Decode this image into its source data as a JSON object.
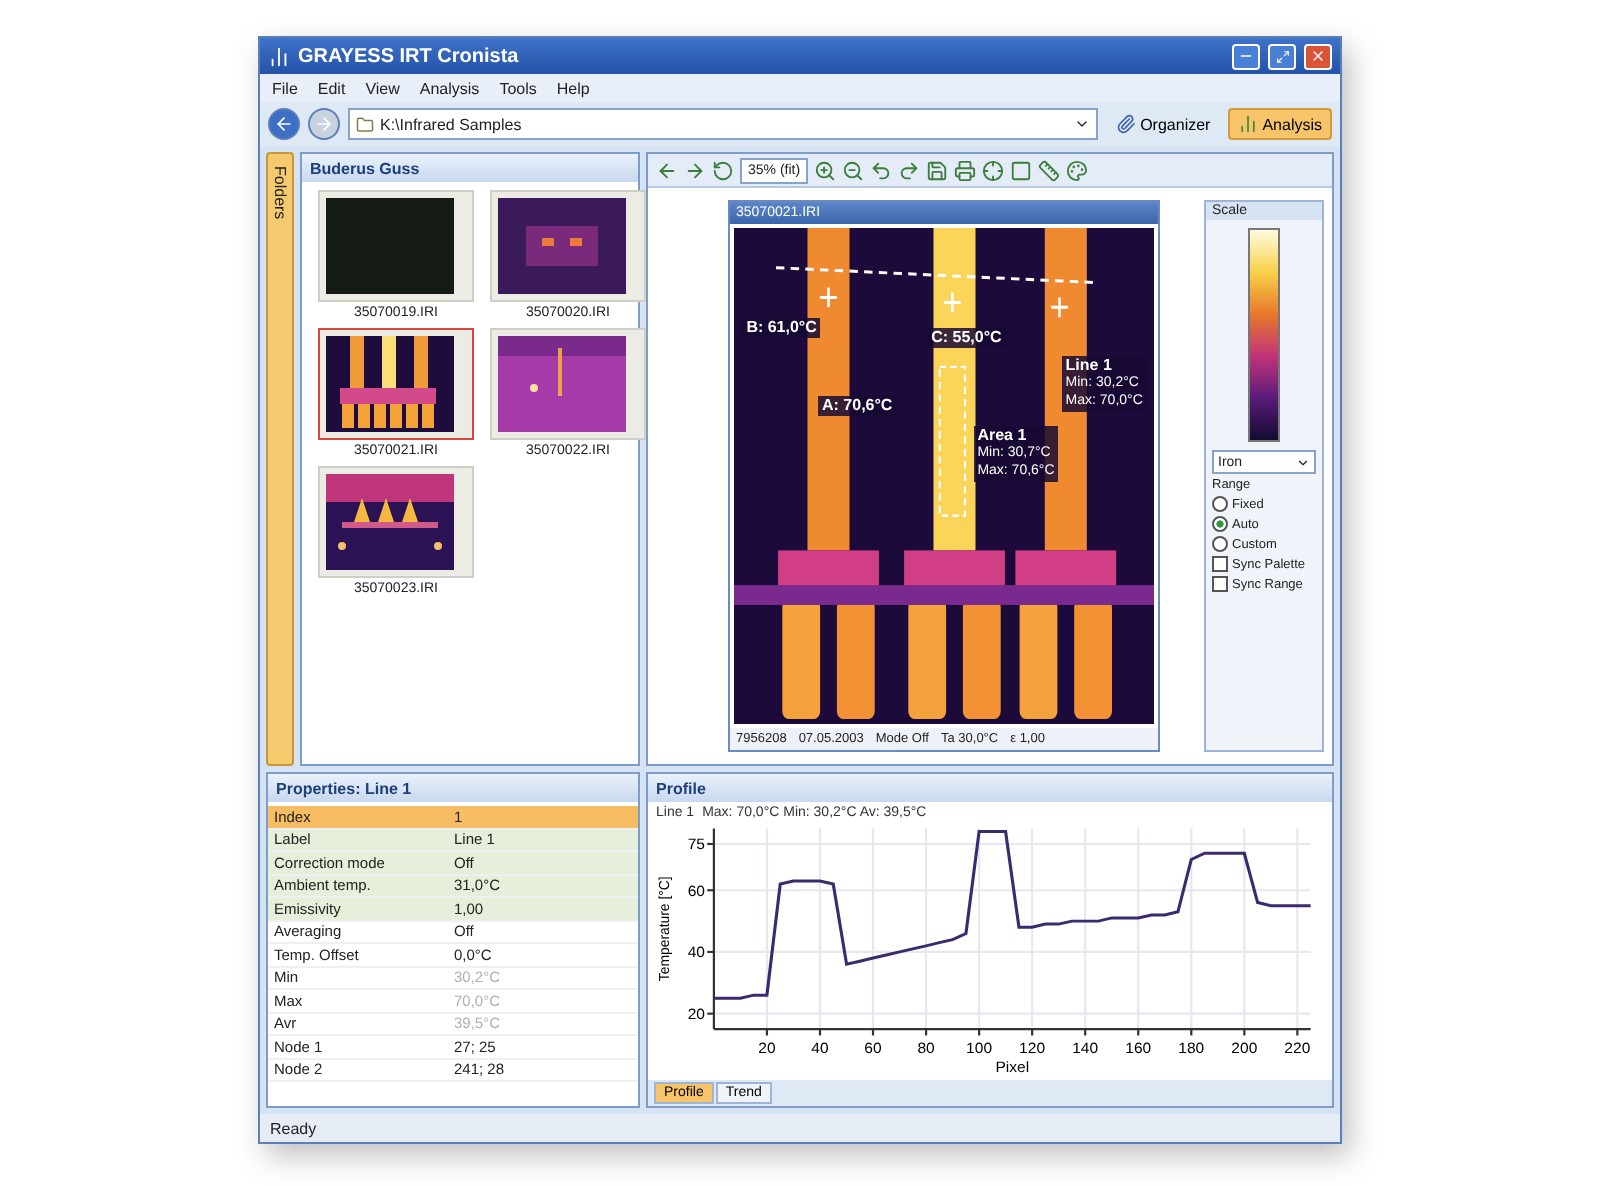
{
  "window": {
    "title": "GRAYESS IRT Cronista"
  },
  "menu": [
    "File",
    "Edit",
    "View",
    "Analysis",
    "Tools",
    "Help"
  ],
  "address": {
    "path": "K:\\Infrared Samples"
  },
  "modes": [
    {
      "label": "Organizer",
      "selected": false
    },
    {
      "label": "Analysis",
      "selected": true
    }
  ],
  "side_tab": "Folders",
  "browser": {
    "title": "Buderus Guss",
    "thumbnails": [
      {
        "name": "35070019.IRI",
        "selected": false,
        "kind": "dark"
      },
      {
        "name": "35070020.IRI",
        "selected": false,
        "kind": "glow"
      },
      {
        "name": "35070021.IRI",
        "selected": true,
        "kind": "busbar"
      },
      {
        "name": "35070022.IRI",
        "selected": false,
        "kind": "plate"
      },
      {
        "name": "35070023.IRI",
        "selected": false,
        "kind": "fuses"
      }
    ]
  },
  "toolbar": {
    "zoom": "35% (fit)"
  },
  "image": {
    "title": "35070021.IRI",
    "annotations": [
      {
        "kind": "spot",
        "text": "B: 61,0°C"
      },
      {
        "kind": "spot",
        "text": "A: 70,6°C"
      },
      {
        "kind": "spot",
        "text": "C: 55,0°C"
      },
      {
        "kind": "area",
        "text": "Area 1",
        "lines": [
          "Min: 30,7°C",
          "Max: 70,6°C"
        ]
      },
      {
        "kind": "line",
        "text": "Line 1",
        "lines": [
          "Min: 30,2°C",
          "Max: 70,0°C"
        ]
      }
    ],
    "status": [
      "7956208",
      "07.05.2003",
      "Mode Off",
      "Ta 30,0°C",
      "ε 1,00"
    ]
  },
  "scale": {
    "title": "Scale",
    "palette": "Iron",
    "range_label": "Range",
    "range_options": [
      {
        "label": "Fixed",
        "selected": false
      },
      {
        "label": "Auto",
        "selected": true
      },
      {
        "label": "Custom",
        "selected": false
      }
    ],
    "options": [
      {
        "label": "Sync Palette",
        "checked": false
      },
      {
        "label": "Sync Range",
        "checked": false
      }
    ]
  },
  "properties": {
    "title": "Properties: Line 1",
    "rows": [
      {
        "label": "Index",
        "value": "1",
        "selected": true,
        "highlighted": false,
        "disabled": false
      },
      {
        "label": "Label",
        "value": "Line 1",
        "selected": false,
        "highlighted": true,
        "disabled": false
      },
      {
        "label": "Correction mode",
        "value": "Off",
        "selected": false,
        "highlighted": true,
        "disabled": false
      },
      {
        "label": "Ambient temp.",
        "value": "31,0°C",
        "selected": false,
        "highlighted": true,
        "disabled": false
      },
      {
        "label": "Emissivity",
        "value": "1,00",
        "selected": false,
        "highlighted": true,
        "disabled": false
      },
      {
        "label": "Averaging",
        "value": "Off",
        "selected": false,
        "highlighted": false,
        "disabled": false
      },
      {
        "label": "Temp. Offset",
        "value": "0,0°C",
        "selected": false,
        "highlighted": false,
        "disabled": false
      },
      {
        "label": "Min",
        "value": "30,2°C",
        "selected": false,
        "highlighted": false,
        "disabled": true
      },
      {
        "label": "Max",
        "value": "70,0°C",
        "selected": false,
        "highlighted": false,
        "disabled": true
      },
      {
        "label": "Avr",
        "value": "39,5°C",
        "selected": false,
        "highlighted": false,
        "disabled": true
      },
      {
        "label": "Node 1",
        "value": "27; 25",
        "selected": false,
        "highlighted": false,
        "disabled": false
      },
      {
        "label": "Node 2",
        "value": "241; 28",
        "selected": false,
        "highlighted": false,
        "disabled": false
      }
    ]
  },
  "profile": {
    "title": "Profile",
    "legend": "Max: 70,0°C Min: 30,2°C Av: 39,5°C",
    "chart_data": {
      "type": "line",
      "grid": true,
      "xlabel": "Pixel",
      "ylabel": "Temperature [°C]",
      "x": [
        0,
        5,
        10,
        15,
        20,
        25,
        30,
        35,
        40,
        45,
        50,
        55,
        60,
        65,
        70,
        75,
        80,
        85,
        90,
        95,
        100,
        105,
        110,
        115,
        120,
        125,
        130,
        135,
        140,
        145,
        150,
        155,
        160,
        165,
        170,
        175,
        180,
        185,
        190,
        195,
        200,
        205,
        210,
        215,
        220,
        225
      ],
      "series": [
        {
          "name": "Line 1",
          "color": "#3b2a6e",
          "values": [
            25,
            25,
            25,
            26,
            26,
            62,
            63,
            63,
            63,
            62,
            36,
            37,
            38,
            39,
            40,
            41,
            42,
            43,
            44,
            46,
            79,
            79,
            79,
            48,
            48,
            49,
            49,
            50,
            50,
            50,
            51,
            51,
            51,
            52,
            52,
            53,
            70,
            72,
            72,
            72,
            72,
            56,
            55,
            55,
            55,
            55
          ]
        }
      ],
      "xlim": [
        0,
        225
      ],
      "ylim": [
        15,
        80
      ],
      "xticks": [
        20,
        40,
        60,
        80,
        100,
        120,
        140,
        160,
        180,
        200,
        220
      ],
      "yticks": [
        20,
        40,
        60,
        75
      ]
    }
  },
  "bottom_tabs": [
    {
      "label": "Profile",
      "selected": true
    },
    {
      "label": "Trend",
      "selected": false
    }
  ],
  "status_bar": "Ready"
}
